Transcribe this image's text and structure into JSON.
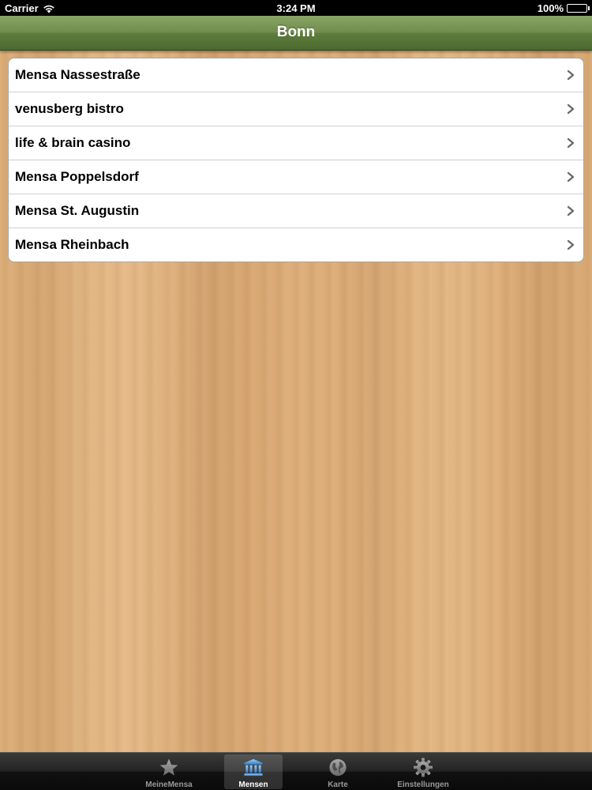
{
  "status_bar": {
    "carrier": "Carrier",
    "time": "3:24 PM",
    "battery": "100%"
  },
  "nav": {
    "title": "Bonn"
  },
  "list": {
    "items": [
      {
        "label": "Mensa Nassestraße"
      },
      {
        "label": "venusberg bistro"
      },
      {
        "label": "life & brain casino"
      },
      {
        "label": "Mensa Poppelsdorf"
      },
      {
        "label": "Mensa St. Augustin"
      },
      {
        "label": "Mensa Rheinbach"
      }
    ]
  },
  "tabs": [
    {
      "label": "MeineMensa",
      "icon": "star-icon",
      "selected": false
    },
    {
      "label": "Mensen",
      "icon": "building-icon",
      "selected": true
    },
    {
      "label": "Karte",
      "icon": "globe-icon",
      "selected": false
    },
    {
      "label": "Einstellungen",
      "icon": "gear-icon",
      "selected": false
    }
  ],
  "colors": {
    "nav_bar": "#6f8d4c",
    "tab_selected_label": "#ffffff",
    "tab_unselected_label": "#999999",
    "wood": "#dcae78"
  }
}
